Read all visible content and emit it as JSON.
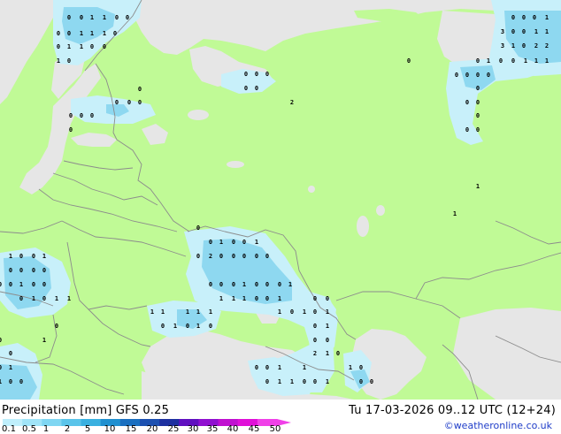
{
  "title": {
    "variable": "Precipitation [mm]",
    "model": "GFS 0.25",
    "valid_time": "Tu 17-03-2026 09..12 UTC (12+24)"
  },
  "credit": "©weatheronline.co.uk",
  "legend": {
    "ticks": [
      "0.1",
      "0.5",
      "1",
      "2",
      "5",
      "10",
      "15",
      "20",
      "25",
      "30",
      "35",
      "40",
      "45",
      "50"
    ],
    "colors": [
      "#bfeffc",
      "#a0e4f8",
      "#7fd6f2",
      "#5ac4ea",
      "#3ab0e0",
      "#2090d0",
      "#1a6fc0",
      "#1c50b0",
      "#1e30a0",
      "#6010c0",
      "#9010d0",
      "#c010d0",
      "#e010d8",
      "#f040e8"
    ]
  },
  "map": {
    "colors": {
      "land": "#c0fa96",
      "sea": "#e6e6e6",
      "precip_light": "#c8f0fa",
      "precip_medium": "#8ed8f0",
      "border": "#8c8c8c"
    },
    "precip_values": [
      "0",
      "0",
      "1",
      "1",
      "0",
      "0",
      "0",
      "0",
      "1",
      "1",
      "1",
      "0",
      "0",
      "1",
      "1",
      "0",
      "0",
      "1",
      "0",
      "0",
      "0",
      "0",
      "0",
      "0",
      "0",
      "0",
      "0",
      "0",
      "0",
      "0",
      "0",
      "0",
      "2",
      "0",
      "0",
      "0",
      "0",
      "1",
      "3",
      "0",
      "0",
      "1",
      "1",
      "3",
      "1",
      "0",
      "2",
      "2",
      "0",
      "1",
      "0",
      "0",
      "1",
      "1",
      "1",
      "0",
      "0",
      "0",
      "0",
      "0",
      "0",
      "0",
      "0",
      "0",
      "0",
      "1",
      "1",
      "0",
      "0",
      "1",
      "0",
      "0",
      "1",
      "0",
      "2",
      "0",
      "0",
      "0",
      "0",
      "0",
      "1",
      "0",
      "0",
      "1",
      "0",
      "0",
      "0",
      "0",
      "0",
      "0",
      "1",
      "0",
      "0",
      "0",
      "0",
      "0",
      "1",
      "0",
      "0",
      "0",
      "1",
      "0",
      "1",
      "0",
      "1",
      "1",
      "1",
      "1",
      "1",
      "0",
      "0",
      "1",
      "0",
      "0",
      "1",
      "1",
      "1",
      "1",
      "1",
      "1",
      "0",
      "1",
      "0",
      "1",
      "0",
      "0",
      "1",
      "0",
      "1",
      "0",
      "0",
      "1",
      "1",
      "0",
      "0",
      "2",
      "1",
      "0",
      "0"
    ]
  }
}
